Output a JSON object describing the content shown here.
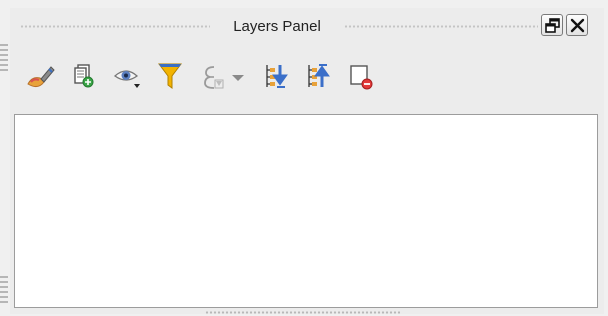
{
  "panel": {
    "title": "Layers Panel"
  },
  "window_buttons": [
    {
      "name": "float",
      "icon": "float-icon"
    },
    {
      "name": "close",
      "icon": "close-icon"
    }
  ],
  "toolbar": {
    "items": [
      {
        "icon": "style-brush-icon"
      },
      {
        "icon": "add-group-icon"
      },
      {
        "icon": "manage-map-themes-icon"
      },
      {
        "icon": "filter-legend-icon"
      },
      {
        "icon": "filter-expression-icon"
      },
      {
        "icon": "dropdown-arrow-icon"
      },
      {
        "icon": "expand-all-icon"
      },
      {
        "icon": "collapse-all-icon"
      },
      {
        "icon": "remove-layer-icon"
      }
    ]
  },
  "colors": {
    "panel_bg": "#ececec",
    "tree_bg": "#ffffff",
    "filter_yellow": "#f2b300",
    "expand_blue": "#3b6fc9",
    "remove_red": "#e23a3a"
  }
}
